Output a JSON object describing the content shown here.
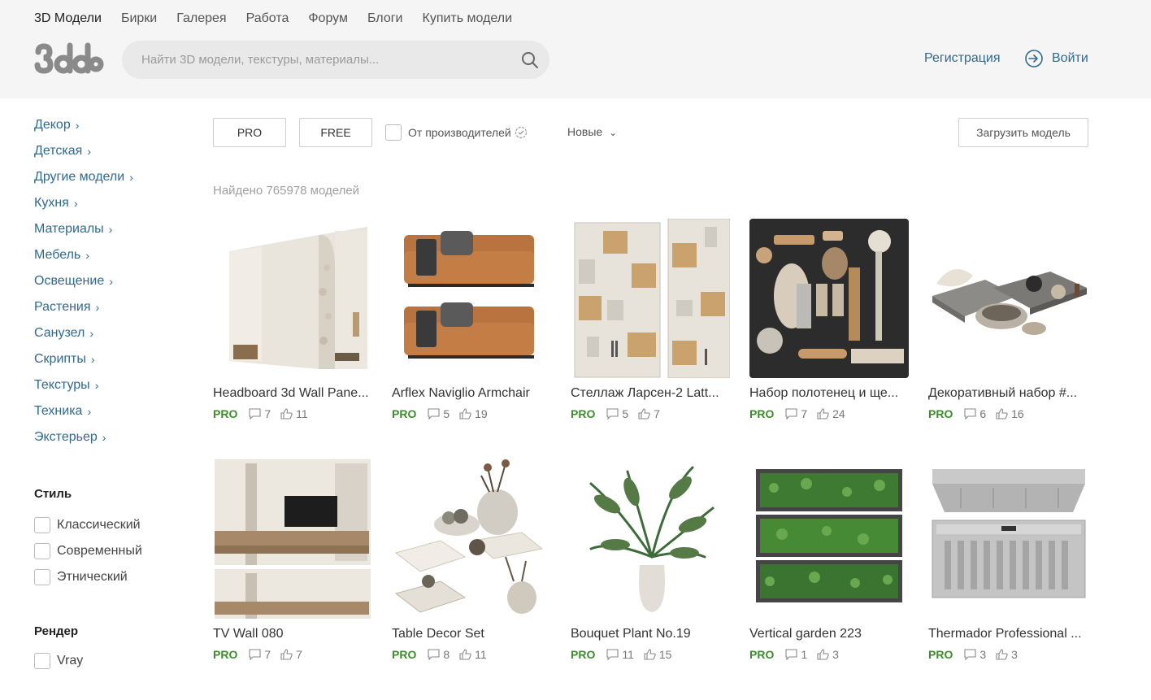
{
  "topnav": [
    "3D Модели",
    "Бирки",
    "Галерея",
    "Работа",
    "Форум",
    "Блоги",
    "Купить модели"
  ],
  "search": {
    "placeholder": "Найти 3D модели, текстуры, материалы..."
  },
  "auth": {
    "register": "Регистрация",
    "login": "Войти"
  },
  "categories": [
    "Декор",
    "Детская",
    "Другие модели",
    "Кухня",
    "Материалы",
    "Мебель",
    "Освещение",
    "Растения",
    "Санузел",
    "Скрипты",
    "Текстуры",
    "Техника",
    "Экстерьер"
  ],
  "style": {
    "title": "Стиль",
    "options": [
      "Классический",
      "Современный",
      "Этнический"
    ]
  },
  "render": {
    "title": "Рендер",
    "options": [
      "Vray"
    ]
  },
  "filters": {
    "pro": "PRO",
    "free": "FREE",
    "maker": "От производителей",
    "sort": "Новые",
    "upload": "Загрузить модель"
  },
  "found": "Найдено 765978 моделей",
  "cards": [
    {
      "title": "Headboard 3d Wall Pane...",
      "badge": "PRO",
      "comments": "7",
      "likes": "11"
    },
    {
      "title": "Arflex Naviglio Armchair",
      "badge": "PRO",
      "comments": "5",
      "likes": "19"
    },
    {
      "title": "Стеллаж Ларсен-2 Latt...",
      "badge": "PRO",
      "comments": "5",
      "likes": "7"
    },
    {
      "title": "Набор полотенец и ще...",
      "badge": "PRO",
      "comments": "7",
      "likes": "24"
    },
    {
      "title": "Декоративный набор #...",
      "badge": "PRO",
      "comments": "6",
      "likes": "16"
    },
    {
      "title": "TV Wall 080",
      "badge": "PRO",
      "comments": "7",
      "likes": "7"
    },
    {
      "title": "Table Decor Set",
      "badge": "PRO",
      "comments": "8",
      "likes": "11"
    },
    {
      "title": "Bouquet Plant No.19",
      "badge": "PRO",
      "comments": "11",
      "likes": "15"
    },
    {
      "title": "Vertical garden 223",
      "badge": "PRO",
      "comments": "1",
      "likes": "3"
    },
    {
      "title": "Thermador Professional ...",
      "badge": "PRO",
      "comments": "3",
      "likes": "3"
    }
  ]
}
